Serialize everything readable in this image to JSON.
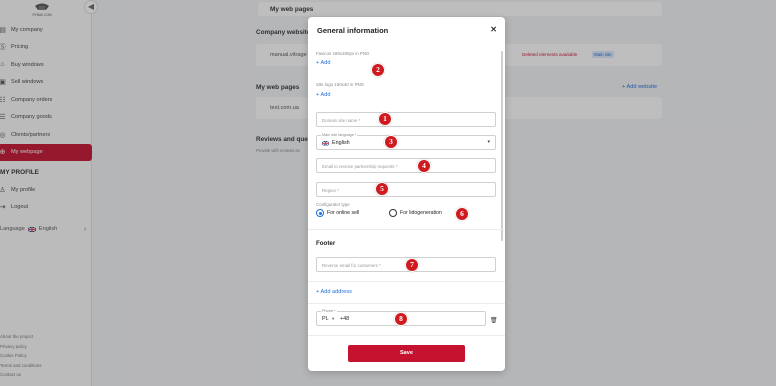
{
  "sidebar": {
    "logo_text": "RYBAK.COM",
    "items": [
      {
        "icon": "building-icon",
        "label": "My company"
      },
      {
        "icon": "dollar-icon",
        "label": "Pricing"
      },
      {
        "icon": "shop-icon",
        "label": "Buy windows"
      },
      {
        "icon": "tag-icon",
        "label": "Sell windows"
      },
      {
        "icon": "orders-icon",
        "label": "Company orders"
      },
      {
        "icon": "goods-icon",
        "label": "Company goods"
      },
      {
        "icon": "partners-icon",
        "label": "Clients/partners"
      },
      {
        "icon": "webpage-icon",
        "label": "My webpage"
      }
    ],
    "profile_title": "MY PROFILE",
    "profile_items": [
      {
        "icon": "user-icon",
        "label": "My profile"
      },
      {
        "icon": "logout-icon",
        "label": "Logout"
      }
    ],
    "language_label": "Language",
    "language_value": "English",
    "footer_links": [
      "About the project",
      "Privacy policy",
      "Cookie Policy",
      "Terms and conditions",
      "Contact us"
    ]
  },
  "background": {
    "my_web_pages_header": "My web pages",
    "company_website_title": "Company website",
    "company_site": "manual.vitrage",
    "deleted_warning": "Deleted elements available",
    "main_site_badge": "Main site",
    "my_web_pages_title": "My web pages",
    "add_website": "+ Add website",
    "web_page_item": "test.com.ua",
    "reviews_title": "Reviews and ques",
    "reviews_sub": "Provide with reviews an"
  },
  "modal": {
    "title": "General information",
    "favicon_label": "Favicon 180x180px in PNG",
    "favicon_add": "+ Add",
    "sitelogo_label": "Site logo 150x40 in PNG",
    "sitelogo_add": "+ Add",
    "domain_placeholder": "Domain site name *",
    "main_language_label": "Main site language *",
    "main_language_value": "English",
    "email_placeholder": "Email to receive partnership requests *",
    "region_placeholder": "Region *",
    "configurator_label": "Configurator type",
    "config_options": [
      "For online sell",
      "For lidogeneration"
    ],
    "config_selected": "For online sell",
    "footer_title": "Footer",
    "reverse_email_placeholder": "Reverse email for customers *",
    "add_address": "+ Add address",
    "phone_label": "Phone *",
    "phone_country": "PL",
    "phone_prefix": "+48",
    "save_label": "Save"
  },
  "badges": [
    "1",
    "2",
    "3",
    "4",
    "5",
    "6",
    "7",
    "8"
  ],
  "colors": {
    "accent": "#c4122f",
    "link": "#1e6fd9",
    "badge": "#cf1a20"
  }
}
